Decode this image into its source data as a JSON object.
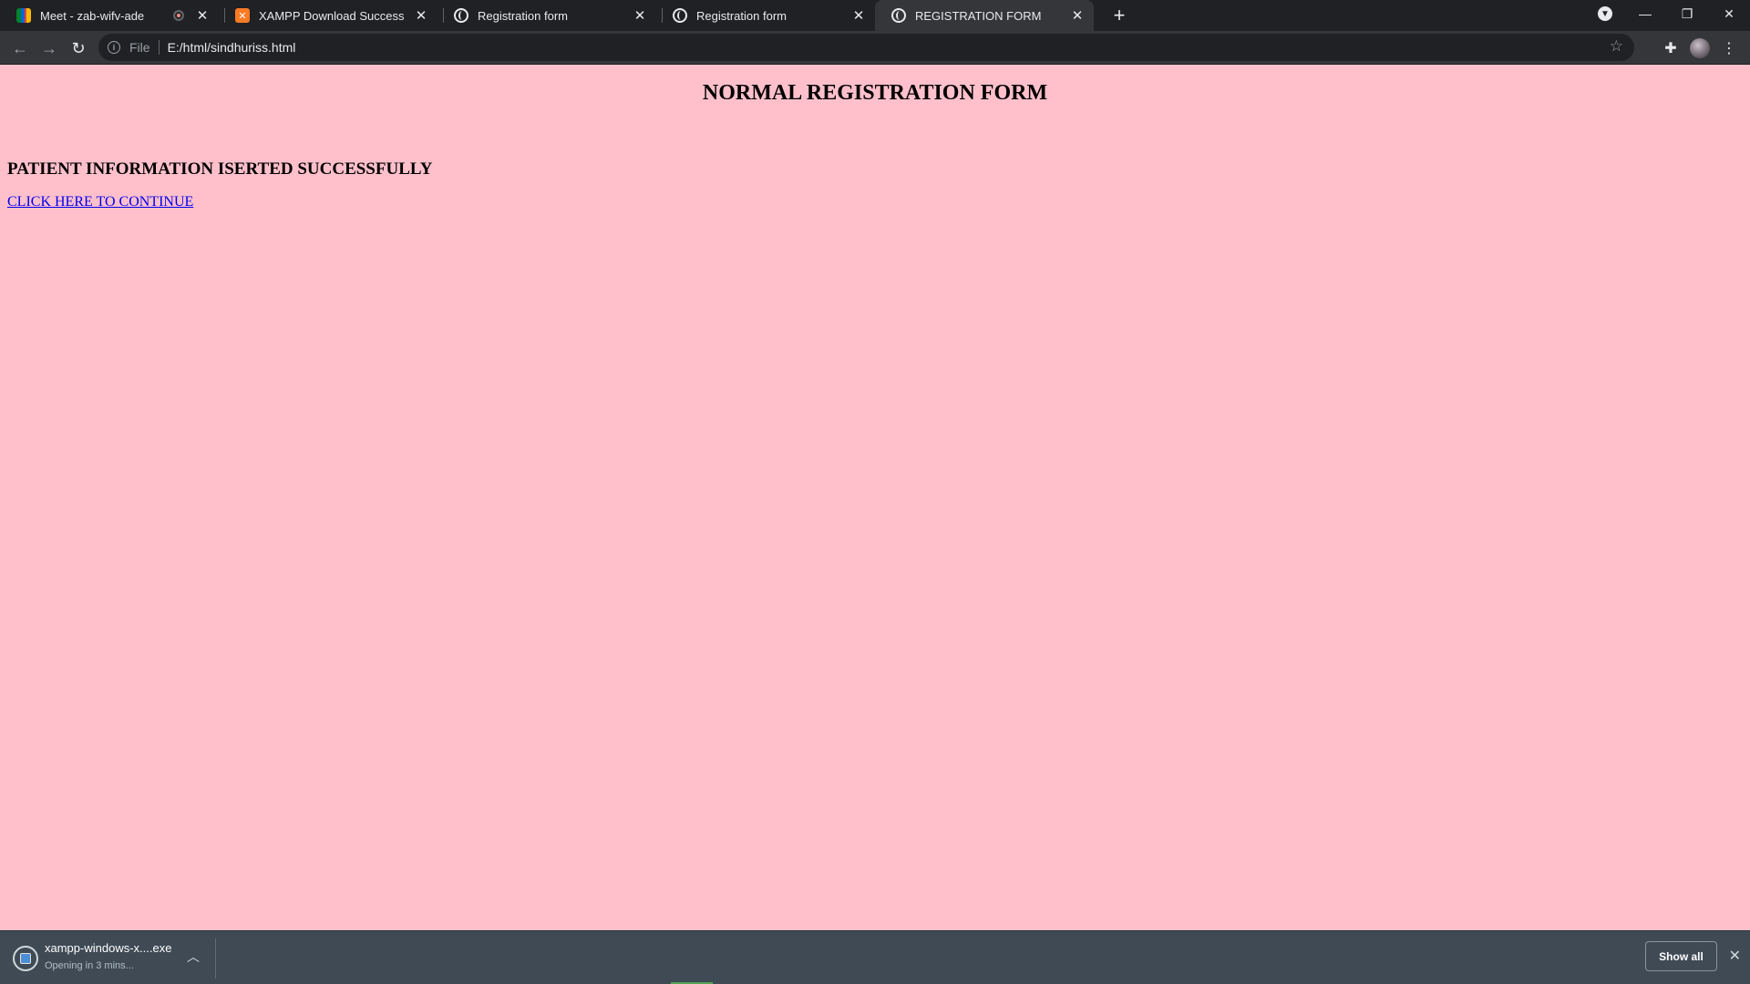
{
  "tabs": [
    {
      "title": "Meet - zab-wifv-ade",
      "favicon": "google-meet-icon",
      "recording": true,
      "active": false
    },
    {
      "title": "XAMPP Download Success",
      "favicon": "xampp-icon",
      "recording": false,
      "active": false
    },
    {
      "title": "Registration form",
      "favicon": "globe-icon",
      "recording": false,
      "active": false
    },
    {
      "title": "Registration form",
      "favicon": "globe-icon",
      "recording": false,
      "active": false
    },
    {
      "title": "REGISTRATION FORM",
      "favicon": "globe-icon",
      "recording": false,
      "active": true
    }
  ],
  "toolbar": {
    "scheme_label": "File",
    "url": "E:/html/sindhuriss.html"
  },
  "page": {
    "heading": "NORMAL REGISTRATION FORM",
    "message": "PATIENT INFORMATION ISERTED SUCCESSFULLY",
    "link_text": "CLICK HERE TO CONTINUE",
    "background_color": "#ffc0cb",
    "link_color": "#0000ee"
  },
  "downloads": {
    "file_name": "xampp-windows-x....exe",
    "status": "Opening in 3 mins...",
    "show_all_label": "Show all"
  },
  "xampp_favicon_glyph": "꧂"
}
